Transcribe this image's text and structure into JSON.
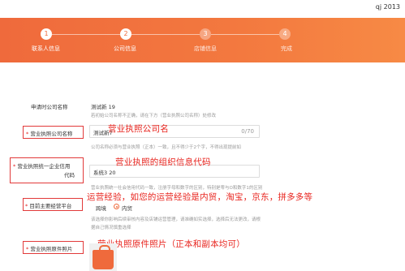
{
  "user": {
    "text": "qj  2013"
  },
  "steps": [
    {
      "num": "1",
      "label": "联系人信息",
      "state": "done"
    },
    {
      "num": "2",
      "label": "公司信息",
      "state": "active"
    },
    {
      "num": "3",
      "label": "店铺信息",
      "state": "todo"
    },
    {
      "num": "4",
      "label": "完成",
      "state": "todo"
    }
  ],
  "company_apply": {
    "label": "申请时公司名称",
    "value": "测试新  19",
    "hint": "若初始公司名称不正确，请在下方（营业执照公司名称）处修改"
  },
  "license_company": {
    "label": "营业执照公司名称",
    "value": "测试新7",
    "counter": "0/70",
    "annotation": "营业执照公司名",
    "hint": "公司名称必须与营业执照（正本）一致，且不得少于2个字，不得出现提前如"
  },
  "credit_code": {
    "label_line1": "营业执照统一企业信用",
    "label_line2": "代码",
    "value": "系统3  20",
    "annotation": "营业执照的组织信息代码",
    "hint": "营业执照统一社会信用代码一致，注册字母和数字的区别，特别是零与O和数字1的区别"
  },
  "platform": {
    "label": "目前主要经营平台",
    "annotation": "运营经验，如您的运营经验是内贸，淘宝，京东，拼多多等",
    "options": [
      "跨境",
      "内贸"
    ],
    "selected": "内贸",
    "hint_line1": "该选择你影响后续审核内容及店铺运营管理，请准确如实选择，选择后无法更改，请根",
    "hint_line2": "据自己情况慎重选择"
  },
  "license_photo": {
    "label": "营业执照原件照片",
    "annotation": "营业执照原件照片（正本和副本均可）"
  },
  "colors": {
    "accent": "#ef6a3c",
    "annotation_red": "#e8251f"
  },
  "icons": {
    "upload": "shopping-bag-icon"
  }
}
